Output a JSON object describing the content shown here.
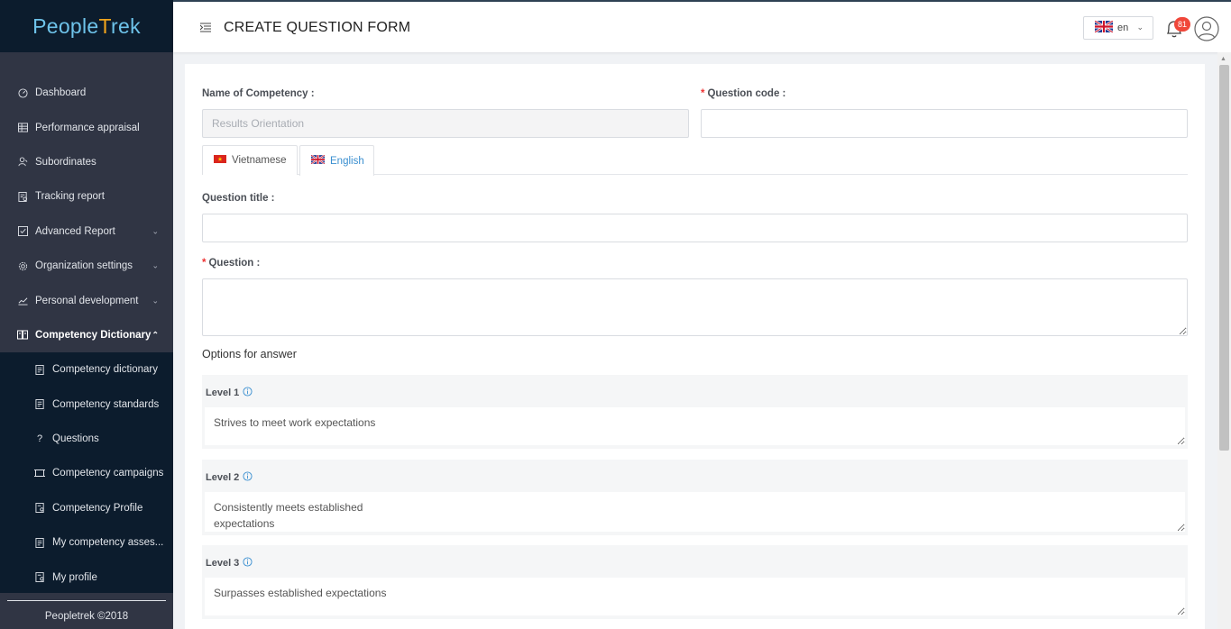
{
  "brand": {
    "name_part1": "People",
    "name_cross": "T",
    "name_part2": "rek"
  },
  "sidebar": {
    "items": [
      {
        "label": "Dashboard",
        "icon": "dashboard-icon",
        "has_chevron": false
      },
      {
        "label": "Performance appraisal",
        "icon": "table-icon",
        "has_chevron": false
      },
      {
        "label": "Subordinates",
        "icon": "users-icon",
        "has_chevron": false
      },
      {
        "label": "Tracking report",
        "icon": "report-icon",
        "has_chevron": false
      },
      {
        "label": "Advanced Report",
        "icon": "checkbox-icon",
        "has_chevron": true
      },
      {
        "label": "Organization settings",
        "icon": "gear-icon",
        "has_chevron": true
      },
      {
        "label": "Personal development",
        "icon": "chart-line-icon",
        "has_chevron": true
      },
      {
        "label": "Competency Dictionary",
        "icon": "book-icon",
        "has_chevron": true,
        "expanded": true
      }
    ],
    "subitems": [
      {
        "label": "Competency dictionary",
        "icon": "document-icon"
      },
      {
        "label": "Competency standards",
        "icon": "document-icon"
      },
      {
        "label": "Questions",
        "icon": "question-icon"
      },
      {
        "label": "Competency campaigns",
        "icon": "campaign-icon"
      },
      {
        "label": "Competency Profile",
        "icon": "profile-doc-icon"
      },
      {
        "label": "My competency asses...",
        "icon": "document-icon"
      },
      {
        "label": "My profile",
        "icon": "profile-doc-icon"
      }
    ],
    "footer": "Peopletrek ©2018"
  },
  "header": {
    "title": "CREATE QUESTION FORM",
    "language": "en",
    "notification_count": "81"
  },
  "form": {
    "competency_label": "Name of Competency :",
    "competency_value": "Results Orientation",
    "question_code_label": "Question code :",
    "question_code_value": "",
    "tabs": [
      {
        "label": "Vietnamese",
        "flag": "vn-flag",
        "active": false
      },
      {
        "label": "English",
        "flag": "uk-flag",
        "active": true
      }
    ],
    "question_title_label": "Question title :",
    "question_title_value": "",
    "question_label": "Question :",
    "question_value": "",
    "options_title": "Options for answer",
    "levels": [
      {
        "label": "Level 1",
        "text": "Strives to meet work expectations"
      },
      {
        "label": "Level 2",
        "text": "Consistently meets established\nexpectations"
      },
      {
        "label": "Level 3",
        "text": "Surpasses established expectations"
      }
    ]
  },
  "colors": {
    "sidebar_bg": "#303544",
    "logo_bg": "#0c1c2d",
    "accent_blue": "#3a8fd0",
    "required_red": "#e33333",
    "badge_red": "#f0473a"
  }
}
